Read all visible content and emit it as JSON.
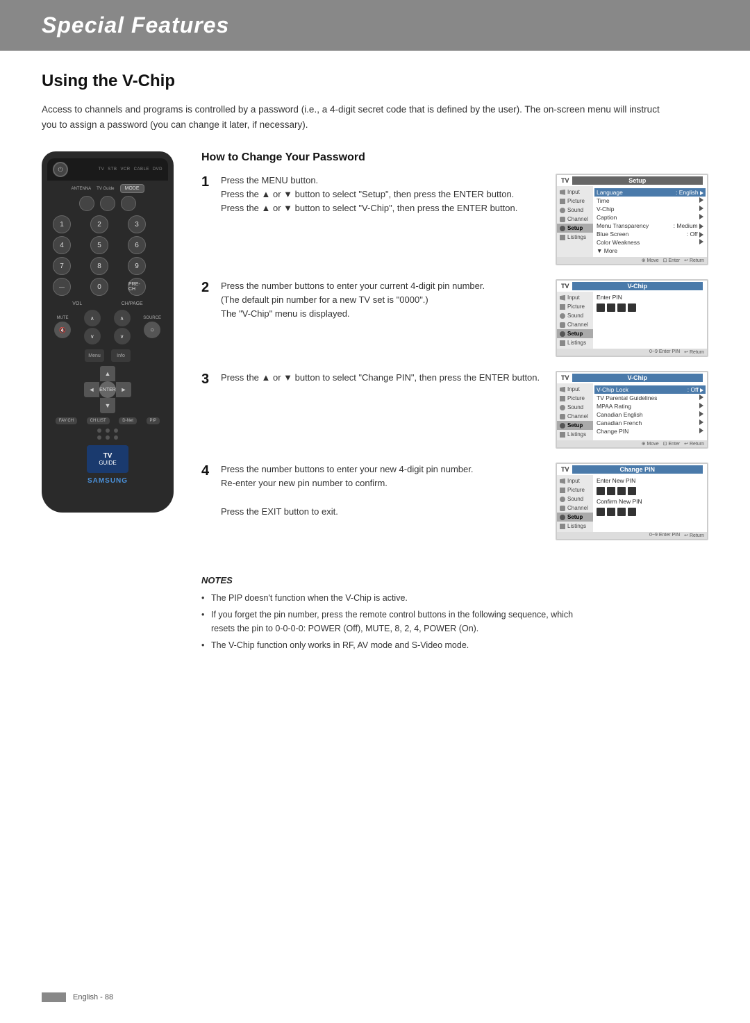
{
  "header": {
    "title": "Special Features",
    "bg_color": "#888"
  },
  "section": {
    "title": "Using the V-Chip",
    "intro": "Access to channels and programs is controlled by a password (i.e., a 4-digit secret code that is defined by the user). The on-screen menu will instruct you to assign a password (you can change it later, if necessary)."
  },
  "howto": {
    "title": "How to Change Your Password",
    "steps": [
      {
        "number": "1",
        "text": "Press the MENU button.\nPress the ▲ or ▼ button to select \"Setup\", then press the ENTER button.\nPress the ▲ or ▼ button to select \"V-Chip\", then press the ENTER button.",
        "screen_title": "Setup",
        "screen_type": "setup"
      },
      {
        "number": "2",
        "text": "Press the number buttons to enter your current 4-digit pin number.\n(The default pin number for a new TV set is \"0000\".)\nThe \"V-Chip\" menu is displayed.",
        "screen_title": "V-Chip",
        "screen_type": "vchip-pin"
      },
      {
        "number": "3",
        "text": "Press the ▲ or ▼ button to select \"Change PIN\", then press the ENTER button.",
        "screen_title": "V-Chip",
        "screen_type": "vchip-menu"
      },
      {
        "number": "4",
        "text": "Press the number buttons to enter your new 4-digit pin number.\nRe-enter your new pin number to confirm.\n\nPress the EXIT button to exit.",
        "screen_title": "Change PIN",
        "screen_type": "change-pin"
      }
    ]
  },
  "side_menu_items": [
    "Input",
    "Picture",
    "Sound",
    "Channel",
    "Setup",
    "Listings"
  ],
  "setup_screen": {
    "items": [
      {
        "label": "Language",
        "value": ": English",
        "arrow": true
      },
      {
        "label": "Time",
        "value": "",
        "arrow": true
      },
      {
        "label": "V-Chip",
        "value": "",
        "arrow": true
      },
      {
        "label": "Caption",
        "value": "",
        "arrow": true
      },
      {
        "label": "Menu Transparency",
        "value": ": Medium",
        "arrow": true
      },
      {
        "label": "Blue Screen",
        "value": ": Off",
        "arrow": true
      },
      {
        "label": "Color Weakness",
        "value": "",
        "arrow": true
      },
      {
        "label": "▼ More",
        "value": "",
        "arrow": false
      }
    ]
  },
  "vchip_menu": {
    "items": [
      {
        "label": "V-Chip Lock",
        "value": ": Off",
        "arrow": true
      },
      {
        "label": "TV Parental Guidelines",
        "value": "",
        "arrow": true
      },
      {
        "label": "MPAA Rating",
        "value": "",
        "arrow": true
      },
      {
        "label": "Canadian English",
        "value": "",
        "arrow": true
      },
      {
        "label": "Canadian French",
        "value": "",
        "arrow": true
      },
      {
        "label": "Change PIN",
        "value": "",
        "arrow": true
      }
    ]
  },
  "change_pin_screen": {
    "items": [
      {
        "label": "Enter New PIN",
        "value": ""
      },
      {
        "label": "Confirm New PIN",
        "value": ""
      }
    ]
  },
  "notes": {
    "title": "NOTES",
    "items": [
      "The PIP doesn't function when the V-Chip is active.",
      "If you forget the pin number, press the remote control buttons in the following sequence, which resets the pin to 0-0-0-0: POWER (Off), MUTE, 8, 2, 4, POWER (On).",
      "The V-Chip function only works in RF, AV mode and S-Video mode."
    ]
  },
  "footer": {
    "text": "English - 88"
  },
  "remote": {
    "power_label": "POWER",
    "source_labels": [
      "TV",
      "STB",
      "VCR",
      "CABLE",
      "DVD"
    ],
    "antenna_label": "ANTENNA",
    "tvguide_label": "TV Guide",
    "mode_label": "MODE",
    "numbers": [
      "1",
      "2",
      "3",
      "4",
      "5",
      "6",
      "7",
      "8",
      "9",
      "—",
      "0",
      "PRE-CH"
    ],
    "vol_label": "VOL",
    "chpage_label": "CH/PAGE",
    "mute_label": "MUTE",
    "source_label": "SOURCE",
    "enter_label": "ENTER",
    "samsung_label": "SAMSUNG",
    "guide_label": "GUIDE",
    "bottom_buttons": [
      "FAV CH",
      "CH LIST",
      "D-Net",
      "PIP"
    ]
  }
}
